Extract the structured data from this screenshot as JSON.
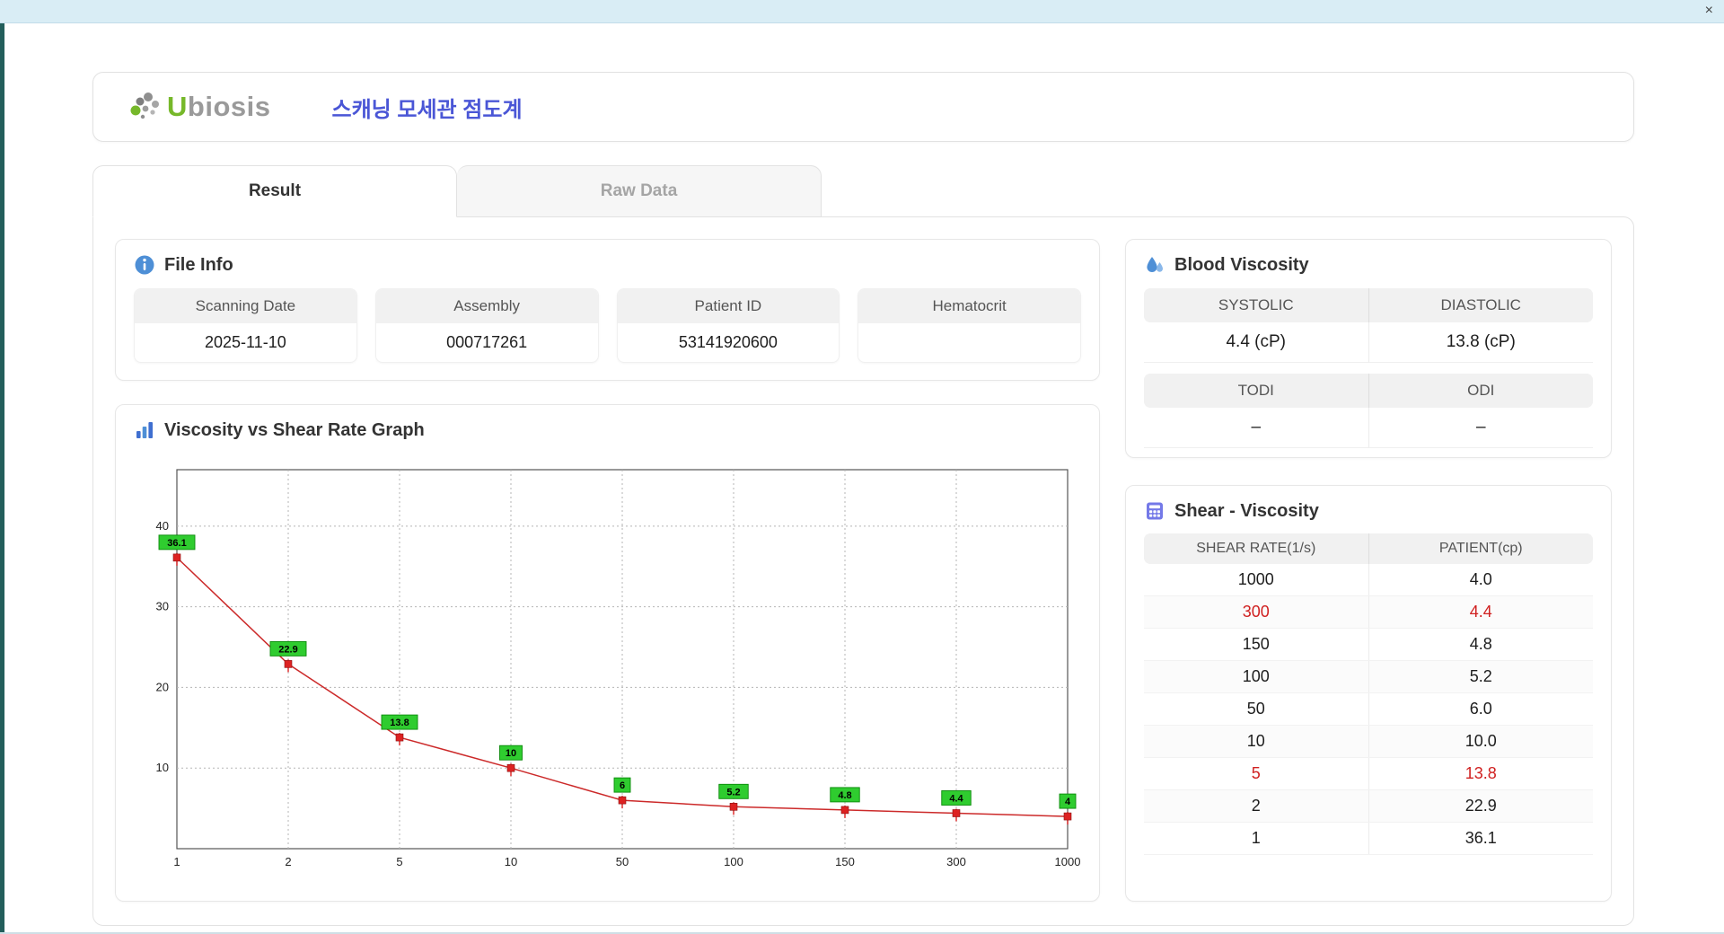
{
  "window": {
    "close_icon": "×"
  },
  "header": {
    "logo_u": "U",
    "logo_rest": "biosis",
    "title": "스캐닝 모세관 점도계"
  },
  "tabs": [
    {
      "label": "Result",
      "active": true
    },
    {
      "label": "Raw Data",
      "active": false
    }
  ],
  "file_info": {
    "title": "File Info",
    "fields": [
      {
        "label": "Scanning Date",
        "value": "2025-11-10"
      },
      {
        "label": "Assembly",
        "value": "000717261"
      },
      {
        "label": "Patient ID",
        "value": "53141920600"
      },
      {
        "label": "Hematocrit",
        "value": ""
      }
    ]
  },
  "blood_viscosity": {
    "title": "Blood Viscosity",
    "groups": [
      {
        "labels": [
          "SYSTOLIC",
          "DIASTOLIC"
        ],
        "values": [
          "4.4 (cP)",
          "13.8 (cP)"
        ]
      },
      {
        "labels": [
          "TODI",
          "ODI"
        ],
        "values": [
          "–",
          "–"
        ]
      }
    ]
  },
  "graph": {
    "title": "Viscosity vs Shear Rate Graph"
  },
  "chart_data": {
    "type": "line",
    "title": "Viscosity vs Shear Rate Graph",
    "categories": [
      "1",
      "2",
      "5",
      "10",
      "50",
      "100",
      "150",
      "300",
      "1000"
    ],
    "values": [
      36.1,
      22.9,
      13.8,
      10,
      6,
      5.2,
      4.8,
      4.4,
      4
    ],
    "point_labels": [
      "36.1",
      "22.9",
      "13.8",
      "10",
      "6",
      "5.2",
      "4.8",
      "4.4",
      "4"
    ],
    "xlabel": "",
    "ylabel": "",
    "yticks": [
      10,
      20,
      30,
      40
    ],
    "ylim": [
      0,
      47
    ],
    "grid": true,
    "legend": false,
    "line_color": "#cc2a2a",
    "marker_color": "#dd2222",
    "label_bg": "#2fcc2f",
    "label_border": "#0a8a0a"
  },
  "shear_table": {
    "title": "Shear - Viscosity",
    "columns": [
      "SHEAR RATE(1/s)",
      "PATIENT(cp)"
    ],
    "rows": [
      {
        "shear": "1000",
        "patient": "4.0",
        "highlight": false
      },
      {
        "shear": "300",
        "patient": "4.4",
        "highlight": true
      },
      {
        "shear": "150",
        "patient": "4.8",
        "highlight": false
      },
      {
        "shear": "100",
        "patient": "5.2",
        "highlight": false
      },
      {
        "shear": "50",
        "patient": "6.0",
        "highlight": false
      },
      {
        "shear": "10",
        "patient": "10.0",
        "highlight": false
      },
      {
        "shear": "5",
        "patient": "13.8",
        "highlight": true
      },
      {
        "shear": "2",
        "patient": "22.9",
        "highlight": false
      },
      {
        "shear": "1",
        "patient": "36.1",
        "highlight": false
      }
    ]
  },
  "colors": {
    "accent_blue": "#4a56d6",
    "icon_blue": "#4e8fd6",
    "icon_purple": "#7479e8",
    "logo_green": "#76b82a",
    "highlight_red": "#d02020",
    "marker_green": "#2fcc2f",
    "line_red": "#cc2a2a"
  }
}
